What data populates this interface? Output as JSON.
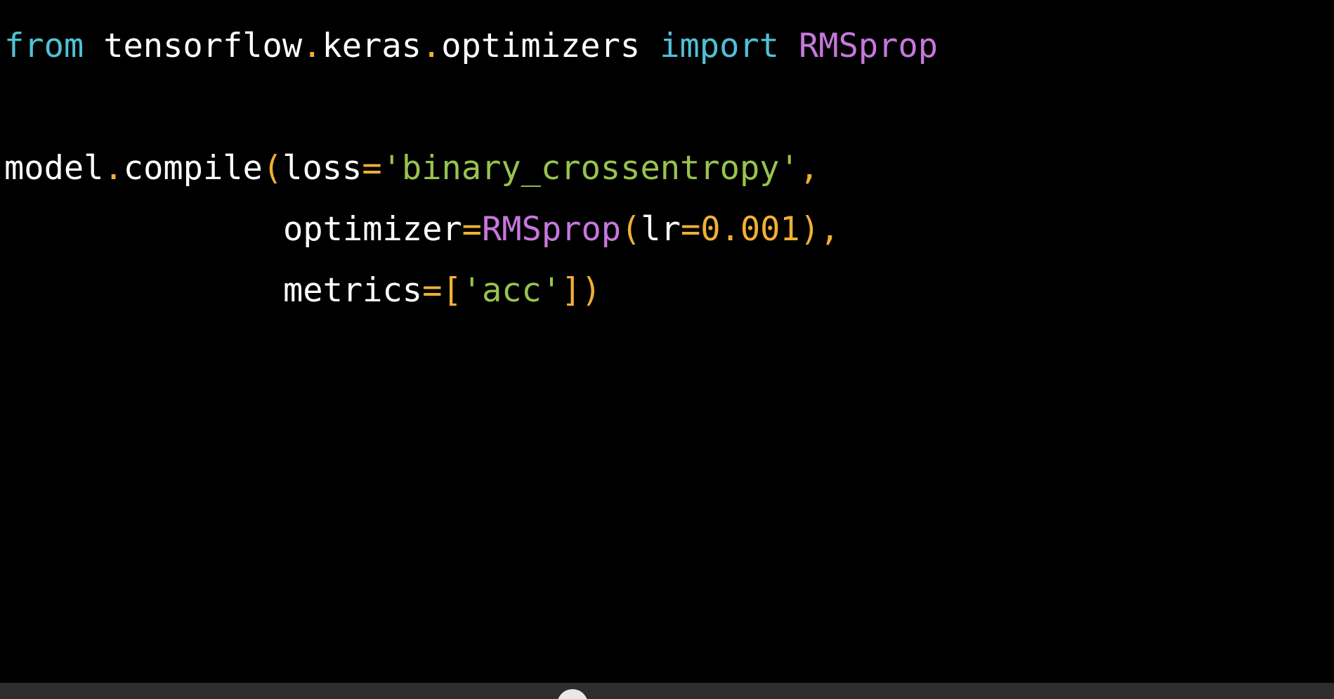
{
  "code": {
    "line1": {
      "kw_from": "from",
      "module": "tensorflow",
      "dot1": ".",
      "module2": "keras",
      "dot2": ".",
      "module3": "optimizers",
      "kw_import": "import",
      "cls": "RMSprop"
    },
    "line3": {
      "obj": "model",
      "dot": ".",
      "method": "compile",
      "paren_open": "(",
      "arg": "loss",
      "eq": "=",
      "str": "'binary_crossentropy'",
      "comma": ","
    },
    "line4": {
      "arg": "optimizer",
      "eq": "=",
      "cls": "RMSprop",
      "paren_open": "(",
      "kwarg": "lr",
      "eq2": "=",
      "num": "0.001",
      "paren_close": ")",
      "comma": ","
    },
    "line5": {
      "arg": "metrics",
      "eq": "=",
      "bracket_open": "[",
      "str": "'acc'",
      "bracket_close": "]",
      "paren_close": ")"
    }
  },
  "colors": {
    "background": "#000000",
    "keyword": "#4fc1d6",
    "class": "#c678dd",
    "string": "#98c34f",
    "punctuation": "#f0b034",
    "text": "#ffffff"
  }
}
